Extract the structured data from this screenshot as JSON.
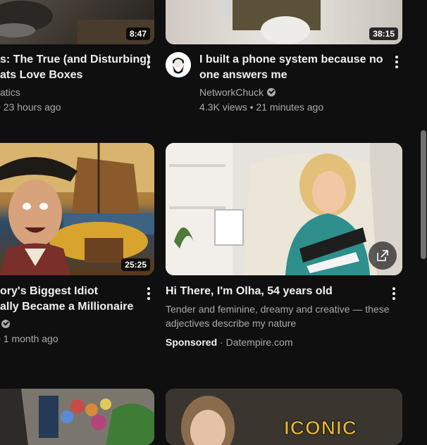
{
  "videos": [
    {
      "title_line1": "s: The True (and Disturbing)",
      "title_line2": "ats Love Boxes",
      "channel": "atics",
      "stats": "• 23 hours ago",
      "duration": "8:47"
    },
    {
      "title_line1": "I built a phone system because no",
      "title_line2": "one answers me",
      "channel": "NetworkChuck",
      "stats": "4.3K views • 21 minutes ago",
      "duration": "38:15"
    },
    {
      "title_line1": "ory's Biggest Idiot",
      "title_line2": "ally Became a Millionaire",
      "channel": "",
      "stats": "1 month ago",
      "duration": "25:25"
    }
  ],
  "ad": {
    "title": "Hi There, I'm Olha, 54 years old",
    "desc_line1": "Tender and feminine, dreamy and creative — these",
    "desc_line2": "adjectives describe my nature",
    "sponsored": "Sponsored",
    "separator": "·",
    "domain": "Datempire.com"
  },
  "bottom_thumb_text": "ICONIC"
}
